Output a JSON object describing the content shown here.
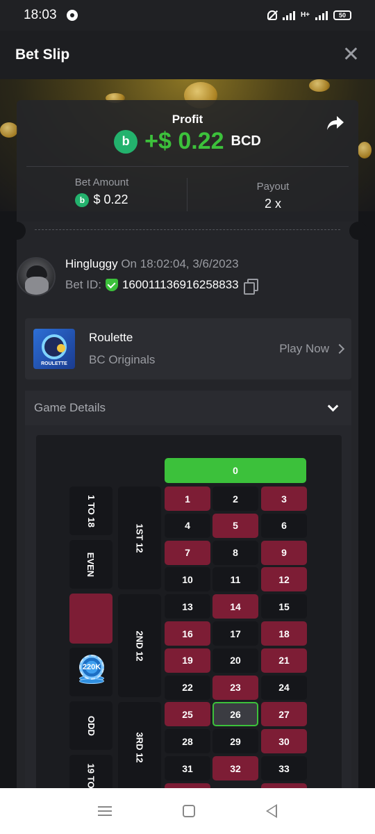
{
  "status_bar": {
    "time": "18:03",
    "network": "H+",
    "battery": "50"
  },
  "header": {
    "title": "Bet Slip",
    "close_symbol": "✕"
  },
  "profit": {
    "label": "Profit",
    "coin_symbol": "b",
    "value": "+$ 0.22",
    "currency": "BCD"
  },
  "stats": {
    "bet_amount_label": "Bet Amount",
    "bet_amount_value": "$ 0.22",
    "payout_label": "Payout",
    "payout_value": "2 x"
  },
  "user": {
    "name": "Hingluggy",
    "timestamp": " On 18:02:04, 3/6/2023",
    "bet_id_label": "Bet ID:",
    "bet_id": "160011136916258833"
  },
  "game": {
    "thumb_label": "ROULETTE",
    "name": "Roulette",
    "provider": "BC Originals",
    "play_label": "Play Now"
  },
  "details": {
    "label": "Game Details"
  },
  "roulette": {
    "zero": "0",
    "numbers": [
      "1",
      "2",
      "3",
      "4",
      "5",
      "6",
      "7",
      "8",
      "9",
      "10",
      "11",
      "12",
      "13",
      "14",
      "15",
      "16",
      "17",
      "18",
      "19",
      "20",
      "21",
      "22",
      "23",
      "24",
      "25",
      "26",
      "27",
      "28",
      "29",
      "30",
      "31",
      "32",
      "33"
    ],
    "colors": [
      "red",
      "black",
      "red",
      "black",
      "red",
      "black",
      "red",
      "black",
      "red",
      "black",
      "black",
      "red",
      "black",
      "red",
      "black",
      "red",
      "black",
      "red",
      "red",
      "black",
      "red",
      "black",
      "red",
      "black",
      "red",
      "black",
      "red",
      "black",
      "black",
      "red",
      "black",
      "red",
      "black"
    ],
    "selected": "26",
    "dozens": [
      "1ST 12",
      "2ND 12",
      "3RD 12"
    ],
    "outside": [
      "1 TO 18",
      "EVEN",
      "ODD",
      "19 TO"
    ],
    "chip_label": "220K",
    "colors_hex": {
      "red": "#7d1d35",
      "black": "#15161a",
      "green": "#3cc13b"
    }
  }
}
